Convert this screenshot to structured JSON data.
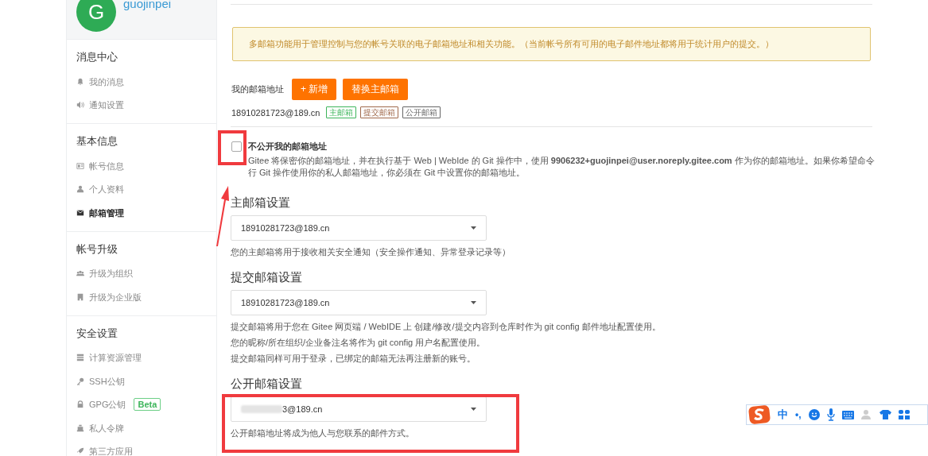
{
  "profile": {
    "avatar_letter": "G",
    "username": "guojinpei"
  },
  "sidebar": {
    "groups": [
      {
        "title": "消息中心",
        "items": [
          {
            "label": "我的消息",
            "selected": false
          },
          {
            "label": "通知设置",
            "selected": false
          }
        ]
      },
      {
        "title": "基本信息",
        "items": [
          {
            "label": "帐号信息",
            "selected": false
          },
          {
            "label": "个人资料",
            "selected": false
          },
          {
            "label": "邮箱管理",
            "selected": true
          }
        ]
      },
      {
        "title": "帐号升级",
        "items": [
          {
            "label": "升级为组织",
            "selected": false
          },
          {
            "label": "升级为企业版",
            "selected": false
          }
        ]
      },
      {
        "title": "安全设置",
        "items": [
          {
            "label": "计算资源管理",
            "selected": false
          },
          {
            "label": "SSH公钥",
            "selected": false
          },
          {
            "label": "GPG公钥",
            "selected": false,
            "badge": "Beta"
          },
          {
            "label": "私人令牌",
            "selected": false
          },
          {
            "label": "第三方应用",
            "selected": false
          }
        ]
      }
    ]
  },
  "notice": "多邮箱功能用于管理控制与您的帐号关联的电子邮箱地址和相关功能。（当前帐号所有可用的电子邮件地址都将用于统计用户的提交。）",
  "email_list": {
    "label": "我的邮箱地址",
    "buttons": [
      "+ 新增",
      "替换主邮箱"
    ],
    "emails": [
      {
        "address": "18910281723@189.cn",
        "tags": [
          {
            "label": "主邮箱",
            "color": "#3cb55a"
          },
          {
            "label": "提交邮箱",
            "color": "#a0694b"
          },
          {
            "label": "公开邮箱",
            "color": "#666666"
          }
        ]
      }
    ]
  },
  "privacy": {
    "checked": false,
    "label": "不公开我的邮箱地址",
    "description": "Gitee 将保密你的邮箱地址，并在执行基于 Web | WebIde 的 Git 操作中，使用 **9906232+guojinpei@user.noreply.gitee.com** 作为你的邮箱地址。如果你希望命令行 Git 操作使用你的私人邮箱地址，你必须在 Git 中设置你的邮箱地址。"
  },
  "sections": [
    {
      "title": "主邮箱设置",
      "value": "18910281723@189.cn",
      "masked": false,
      "help": [
        "您的主邮箱将用于接收相关安全通知（安全操作通知、异常登录记录等）"
      ]
    },
    {
      "title": "提交邮箱设置",
      "value": "18910281723@189.cn",
      "masked": false,
      "help": [
        "提交邮箱将用于您在 Gitee 网页端 / WebIDE 上 创建/修改/提交内容到仓库时作为 git config 邮件地址配置使用。",
        "您的昵称/所在组织/企业备注名将作为 git config 用户名配置使用。",
        "提交邮箱同样可用于登录，已绑定的邮箱无法再注册新的账号。"
      ]
    },
    {
      "title": "公开邮箱设置",
      "value": "3@189.cn",
      "masked": true,
      "help": [
        "公开邮箱地址将成为他人与您联系的邮件方式。"
      ]
    }
  ],
  "ime_bar": {
    "mode": "中",
    "punctuation": "•,"
  }
}
